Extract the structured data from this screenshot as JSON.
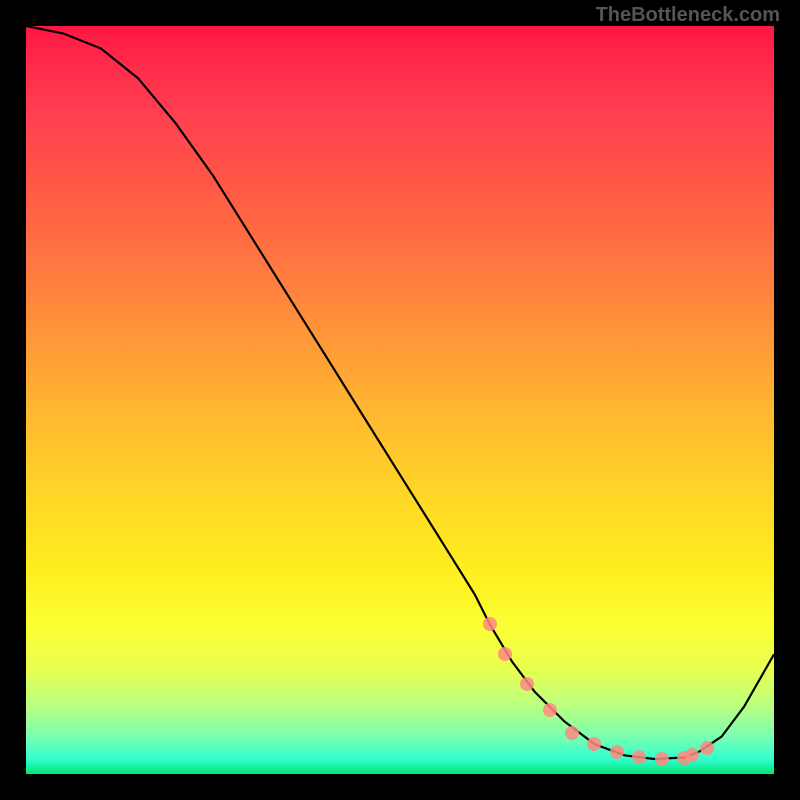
{
  "watermark": "TheBottleneck.com",
  "chart_data": {
    "type": "line",
    "title": "",
    "xlabel": "",
    "ylabel": "",
    "x_range": [
      0,
      100
    ],
    "y_range": [
      0,
      100
    ],
    "curve": {
      "x": [
        0,
        5,
        10,
        15,
        20,
        25,
        30,
        35,
        40,
        45,
        50,
        55,
        60,
        62,
        65,
        68,
        72,
        76,
        80,
        84,
        88,
        90,
        93,
        96,
        100
      ],
      "y": [
        100,
        99,
        97,
        93,
        87,
        80,
        72,
        64,
        56,
        48,
        40,
        32,
        24,
        20,
        15,
        11,
        7,
        4,
        2.5,
        2,
        2.2,
        3,
        5,
        9,
        16
      ]
    },
    "highlighted_points": {
      "x": [
        62,
        64,
        67,
        70,
        73,
        76,
        79,
        82,
        85,
        88,
        89,
        91
      ],
      "y": [
        20,
        16,
        12,
        8.5,
        5.5,
        4,
        3,
        2.3,
        2,
        2.2,
        2.5,
        3.5
      ]
    },
    "gradient_colors": [
      "#ff1744",
      "#ff6e40",
      "#ffd740",
      "#eeff41",
      "#69f0ae",
      "#00e676"
    ]
  }
}
